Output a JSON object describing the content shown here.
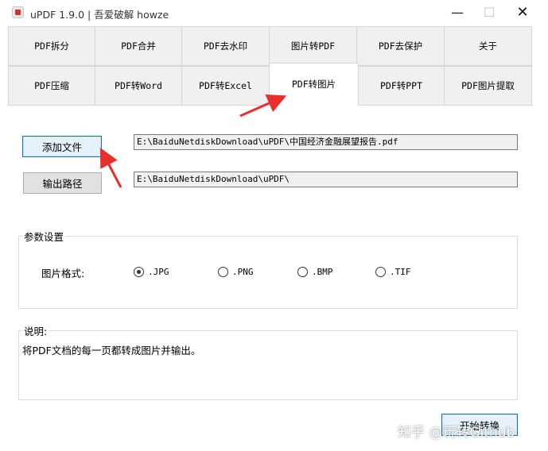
{
  "window": {
    "title": "uPDF 1.9.0 |  吾爱破解 howze",
    "controls": {
      "minimize": "—",
      "maximize": "☐",
      "close": "✕"
    }
  },
  "tabs": {
    "row1": [
      "PDF拆分",
      "PDF合并",
      "PDF去水印",
      "图片转PDF",
      "PDF去保护",
      "关于"
    ],
    "row2": [
      "PDF压缩",
      "PDF转Word",
      "PDF转Excel",
      "PDF转图片",
      "PDF转PPT",
      "PDF图片提取"
    ],
    "active": "PDF转图片"
  },
  "files": {
    "add_button": "添加文件",
    "input_path": "E:\\BaiduNetdiskDownload\\uPDF\\中国经济金融展望报告.pdf",
    "output_button": "输出路径",
    "output_path": "E:\\BaiduNetdiskDownload\\uPDF\\"
  },
  "params": {
    "group_title": "参数设置",
    "format_label": "图片格式:",
    "formats": [
      ".JPG",
      ".PNG",
      ".BMP",
      ".TIF"
    ],
    "selected": ".JPG"
  },
  "description": {
    "title": "说明:",
    "text": "将PDF文档的每一页都转成图片并输出。"
  },
  "start_button": "开始转换",
  "watermark": "知乎 @玩转Github",
  "colors": {
    "annotation_arrow": "#e8302a",
    "focus_border": "#0078d7"
  }
}
